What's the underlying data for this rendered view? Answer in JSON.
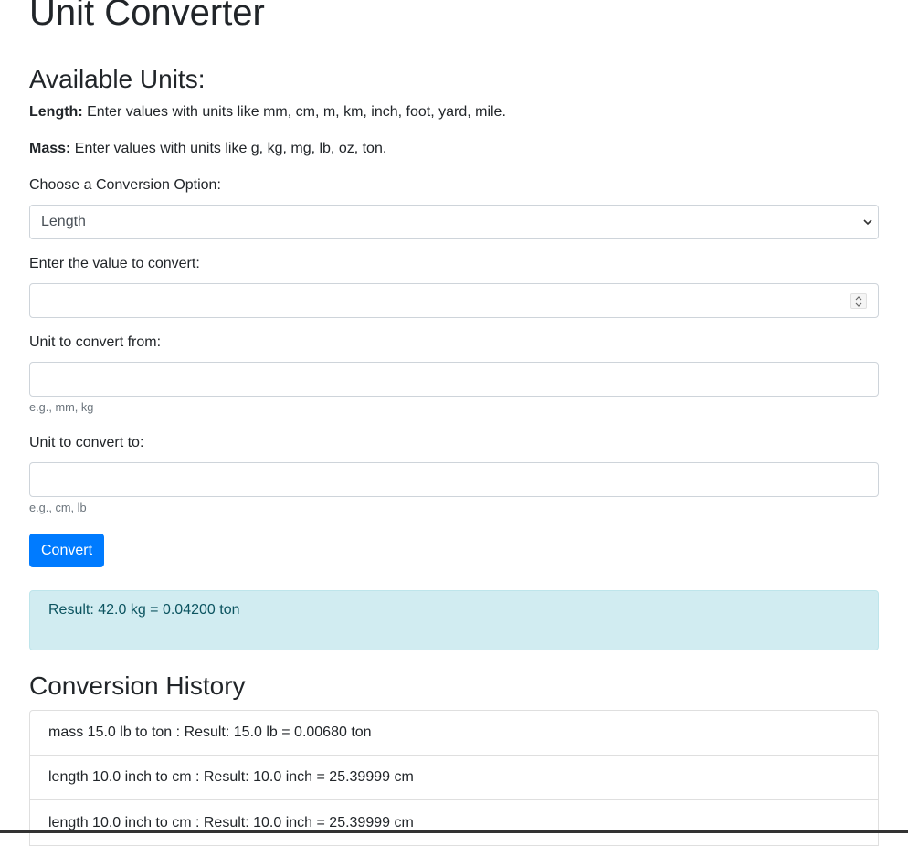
{
  "page": {
    "title": "Unit Converter",
    "available_heading": "Available Units:"
  },
  "units": {
    "length_label": "Length:",
    "length_text": " Enter values with units like mm, cm, m, km, inch, foot, yard, mile.",
    "mass_label": "Mass:",
    "mass_text": " Enter values with units like g, kg, mg, lb, oz, ton."
  },
  "form": {
    "option_label": "Choose a Conversion Option:",
    "option_selected": "Length",
    "value_label": "Enter the value to convert:",
    "value": "",
    "from_label": "Unit to convert from:",
    "from_value": "",
    "from_hint": "e.g., mm, kg",
    "to_label": "Unit to convert to:",
    "to_value": "",
    "to_hint": "e.g., cm, lb",
    "convert_label": "Convert"
  },
  "result": {
    "text": "Result: 42.0 kg = 0.04200 ton"
  },
  "history": {
    "heading": "Conversion History",
    "items": [
      "mass 15.0 lb to ton : Result: 15.0 lb = 0.00680 ton",
      "length 10.0 inch to cm : Result: 10.0 inch = 25.39999 cm",
      "length 10.0 inch to cm : Result: 10.0 inch = 25.39999 cm"
    ]
  },
  "icons": {
    "select": "chevron-down-icon",
    "stepper": "spinner-icon"
  },
  "colors": {
    "primary": "#007bff",
    "info_bg": "#d1ecf1",
    "info_text": "#0c5460"
  }
}
